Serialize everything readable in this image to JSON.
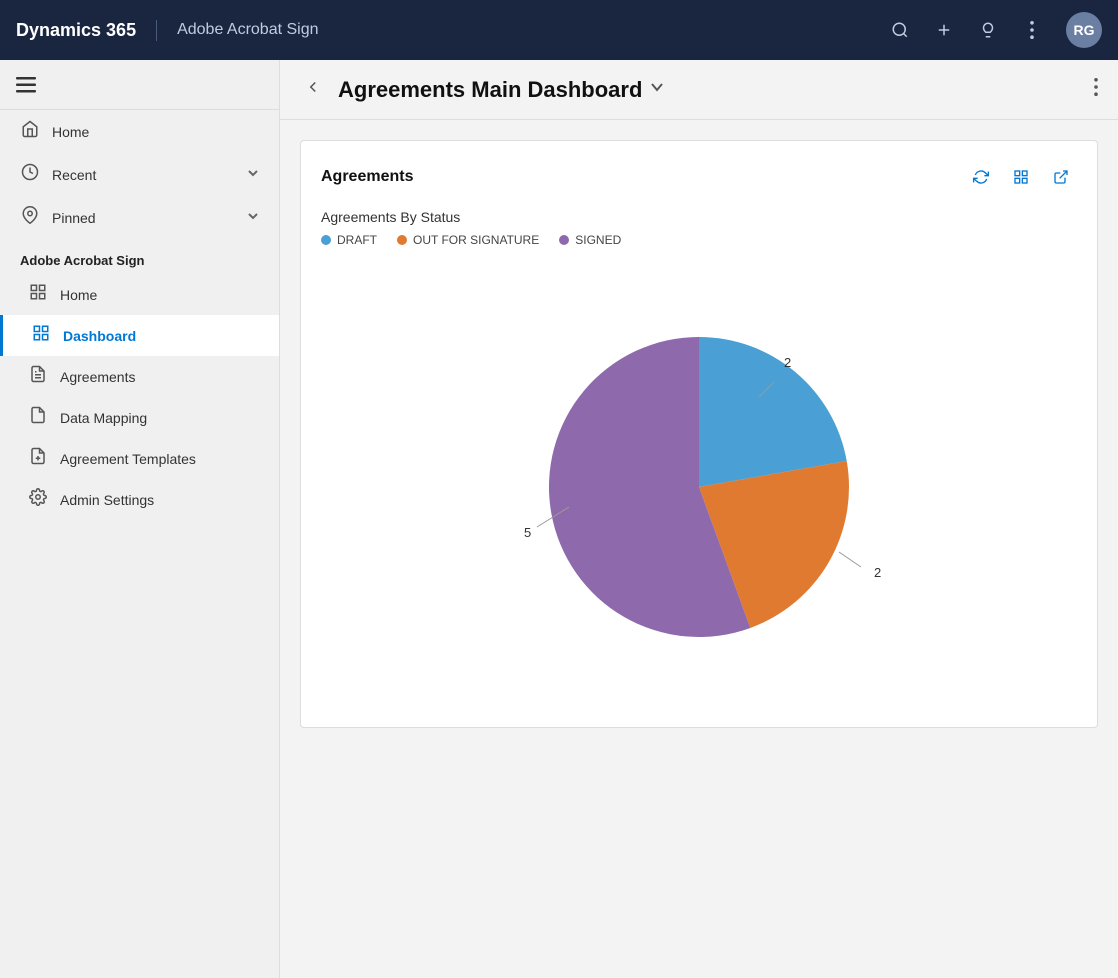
{
  "topbar": {
    "title": "Dynamics 365",
    "app_name": "Adobe Acrobat Sign",
    "search_icon": "🔍",
    "add_icon": "+",
    "lightbulb_icon": "💡",
    "more_icon": "⋮",
    "avatar_initials": "RG"
  },
  "sidebar": {
    "hamburger_label": "☰",
    "nav_items": [
      {
        "id": "home",
        "label": "Home",
        "icon": "⌂",
        "has_chevron": false
      },
      {
        "id": "recent",
        "label": "Recent",
        "icon": "🕐",
        "has_chevron": true
      },
      {
        "id": "pinned",
        "label": "Pinned",
        "icon": "📌",
        "has_chevron": true
      }
    ],
    "section_title": "Adobe Acrobat Sign",
    "sub_items": [
      {
        "id": "home2",
        "label": "Home",
        "icon": "⊞",
        "active": false
      },
      {
        "id": "dashboard",
        "label": "Dashboard",
        "icon": "⊞",
        "active": true
      },
      {
        "id": "agreements",
        "label": "Agreements",
        "icon": "📄",
        "active": false
      },
      {
        "id": "data-mapping",
        "label": "Data Mapping",
        "icon": "📋",
        "active": false
      },
      {
        "id": "agreement-templates",
        "label": "Agreement Templates",
        "icon": "📝",
        "active": false
      },
      {
        "id": "admin-settings",
        "label": "Admin Settings",
        "icon": "⚙",
        "active": false
      }
    ]
  },
  "header": {
    "back_icon": "←",
    "title": "Agreements Main Dashboard",
    "dropdown_icon": "∨",
    "more_icon": "⋮"
  },
  "card": {
    "title": "Agreements",
    "refresh_icon": "↻",
    "view_icon": "⊞",
    "expand_icon": "↗",
    "chart_section_title": "Agreements By Status",
    "legend": [
      {
        "id": "draft",
        "label": "DRAFT",
        "color": "#4a9fd4"
      },
      {
        "id": "out-for-signature",
        "label": "OUT FOR SIGNATURE",
        "color": "#e07a30"
      },
      {
        "id": "signed",
        "label": "SIGNED",
        "color": "#8e6aad"
      }
    ],
    "chart": {
      "data": [
        {
          "label": "DRAFT",
          "value": 2,
          "color": "#4a9fd4",
          "startAngle": 0,
          "endAngle": 80
        },
        {
          "label": "OUT FOR SIGNATURE",
          "value": 2,
          "color": "#e07a30",
          "startAngle": 80,
          "endAngle": 160
        },
        {
          "label": "SIGNED",
          "value": 5,
          "color": "#8e6aad",
          "startAngle": 160,
          "endAngle": 360
        }
      ],
      "draft_value": "2",
      "out_for_sig_value": "2",
      "signed_value": "5"
    }
  }
}
